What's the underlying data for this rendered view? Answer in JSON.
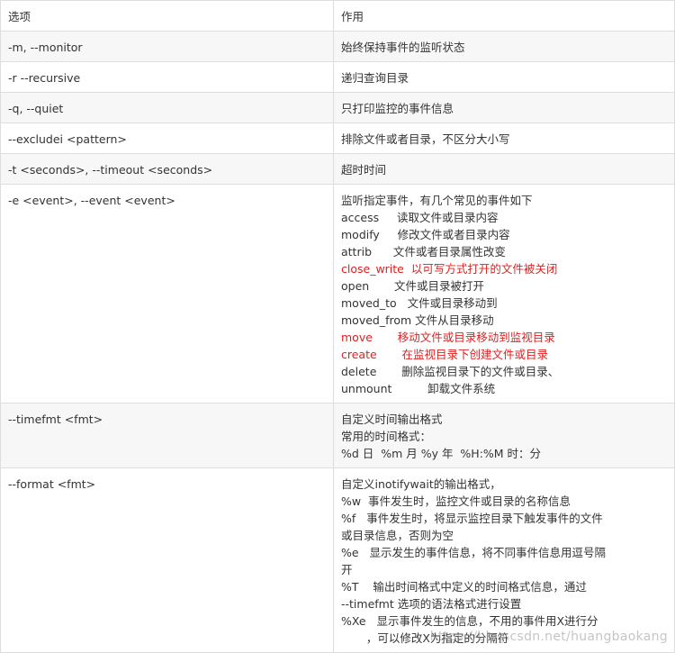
{
  "header": {
    "col1": "选项",
    "col2": "作用"
  },
  "rows": [
    {
      "option": "-m, --monitor",
      "desc": [
        "始终保持事件的监听状态"
      ]
    },
    {
      "option": "-r  --recursive",
      "desc": [
        "递归查询目录"
      ]
    },
    {
      "option": "-q, --quiet",
      "desc": [
        "只打印监控的事件信息"
      ]
    },
    {
      "option": "--excludei  <pattern>",
      "desc": [
        "排除文件或者目录，不区分大小写"
      ]
    },
    {
      "option": "-t <seconds>, --timeout <seconds>",
      "desc": [
        "超时时间"
      ]
    },
    {
      "option": "-e <event>, --event <event>",
      "desc": [
        "监听指定事件，有几个常见的事件如下",
        "access     读取文件或目录内容",
        "modify     修改文件或者目录内容",
        "attrib      文件或者目录属性改变",
        "close_write  以可写方式打开的文件被关闭",
        "open       文件或目录被打开",
        "moved_to   文件或目录移动到",
        "moved_from 文件从目录移动",
        "move       移动文件或目录移动到监视目录",
        "create       在监视目录下创建文件或目录",
        "delete       删除监视目录下的文件或目录、",
        "unmount          卸载文件系统"
      ]
    },
    {
      "option": "--timefmt <fmt>",
      "desc": [
        "自定义时间输出格式",
        "常用的时间格式：",
        "%d 日  %m 月 %y 年  %H:%M 时：分"
      ]
    },
    {
      "option": "--format <fmt>",
      "desc": [
        "自定义inotifywait的输出格式，",
        "%w  事件发生时，监控文件或目录的名称信息",
        "%f   事件发生时，将显示监控目录下触发事件的文件",
        "或目录信息，否则为空",
        "%e   显示发生的事件信息，将不同事件信息用逗号隔",
        "开",
        "%T    输出时间格式中定义的时间格式信息，通过",
        "--timefmt 选项的语法格式进行设置",
        "%Xe   显示事件发生的信息，不用的事件用X进行分",
        "       ，可以修改X为指定的分隔符"
      ]
    }
  ],
  "highlight_lines": {
    "event_red": [
      4,
      8,
      9
    ]
  },
  "colors": {
    "red": "#e02020",
    "text": "#333333",
    "alt_bg": "#f7f7f7",
    "border": "#dddddd"
  },
  "watermark": "https://blog.csdn.net/huangbaokang"
}
